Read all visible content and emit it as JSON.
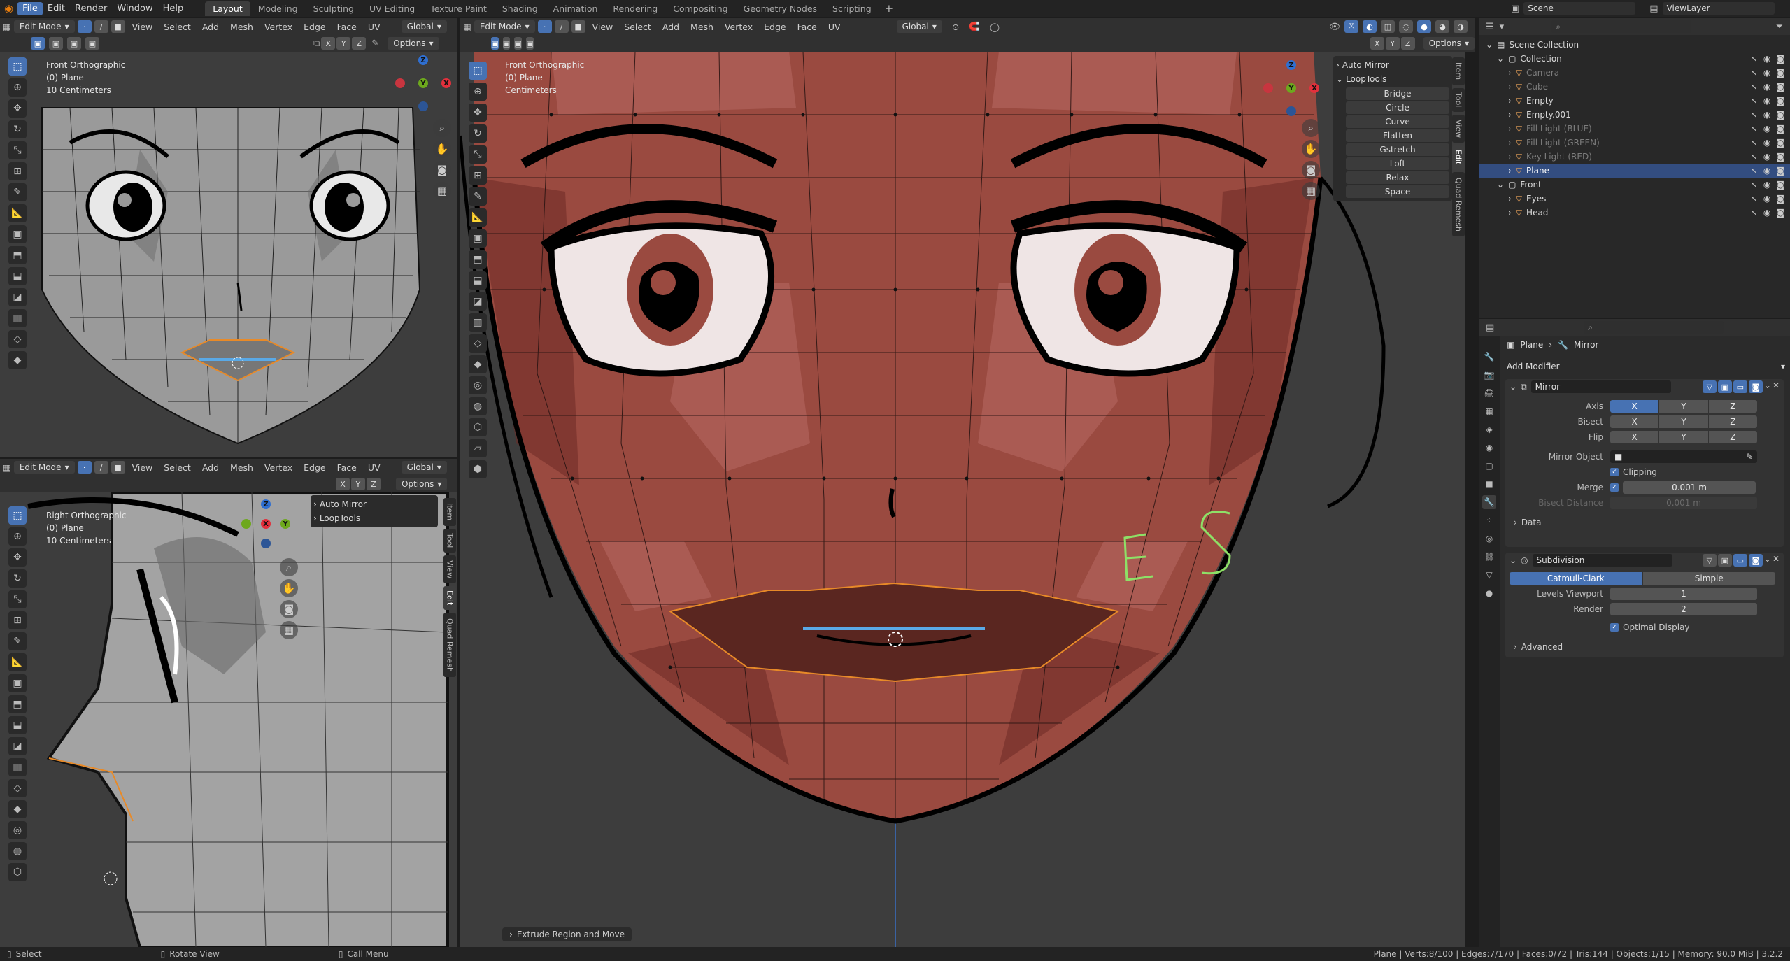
{
  "topbar": {
    "menus": [
      "File",
      "Edit",
      "Render",
      "Window",
      "Help"
    ],
    "workspaces": [
      "Layout",
      "Modeling",
      "Sculpting",
      "UV Editing",
      "Texture Paint",
      "Shading",
      "Animation",
      "Rendering",
      "Compositing",
      "Geometry Nodes",
      "Scripting"
    ],
    "active_workspace": "Layout",
    "scene": "Scene",
    "viewlayer": "ViewLayer"
  },
  "viewport_header": {
    "mode": "Edit Mode",
    "menus": [
      "View",
      "Select",
      "Add",
      "Mesh",
      "Vertex",
      "Edge",
      "Face",
      "UV"
    ],
    "orientation": "Global",
    "axes": [
      "X",
      "Y",
      "Z"
    ],
    "options": "Options"
  },
  "viewport_topleft": {
    "view_name": "Front Orthographic",
    "object": "(0) Plane",
    "scale": "10 Centimeters"
  },
  "viewport_bottomleft": {
    "view_name": "Right Orthographic",
    "object": "(0) Plane",
    "scale": "10 Centimeters"
  },
  "viewport_main": {
    "view_name": "Front Orthographic",
    "object": "(0) Plane",
    "scale": "Centimeters",
    "last_op": "Extrude Region and Move"
  },
  "npanel": {
    "auto_mirror": "Auto Mirror",
    "looptools": "LoopTools",
    "looptools_ops": [
      "Bridge",
      "Circle",
      "Curve",
      "Flatten",
      "Gstretch",
      "Loft",
      "Relax",
      "Space"
    ],
    "tabs": [
      "Item",
      "Tool",
      "View",
      "Edit",
      "Quad Remesh"
    ]
  },
  "gizmo": {
    "x": "X",
    "y": "Y",
    "z": "Z"
  },
  "drawing": {
    "signature": "E S"
  },
  "outliner": {
    "rows": [
      {
        "label": "Scene Collection",
        "indent": 0,
        "dim": false,
        "sel": false
      },
      {
        "label": "Collection",
        "indent": 1,
        "dim": false,
        "sel": false
      },
      {
        "label": "Camera",
        "indent": 2,
        "dim": true,
        "sel": false
      },
      {
        "label": "Cube",
        "indent": 2,
        "dim": true,
        "sel": false
      },
      {
        "label": "Empty",
        "indent": 2,
        "dim": false,
        "sel": false
      },
      {
        "label": "Empty.001",
        "indent": 2,
        "dim": false,
        "sel": false
      },
      {
        "label": "Fill Light (BLUE)",
        "indent": 2,
        "dim": true,
        "sel": false
      },
      {
        "label": "Fill Light (GREEN)",
        "indent": 2,
        "dim": true,
        "sel": false
      },
      {
        "label": "Key Light (RED)",
        "indent": 2,
        "dim": true,
        "sel": false
      },
      {
        "label": "Plane",
        "indent": 2,
        "dim": false,
        "sel": true
      },
      {
        "label": "Front",
        "indent": 1,
        "dim": false,
        "sel": false
      },
      {
        "label": "Eyes",
        "indent": 2,
        "dim": false,
        "sel": false
      },
      {
        "label": "Head",
        "indent": 2,
        "dim": false,
        "sel": false
      }
    ]
  },
  "properties": {
    "breadcrumb_object": "Plane",
    "breadcrumb_modifier": "Mirror",
    "add_modifier": "Add Modifier",
    "mirror": {
      "name": "Mirror",
      "axis_label": "Axis",
      "bisect_label": "Bisect",
      "flip_label": "Flip",
      "xyz": [
        "X",
        "Y",
        "Z"
      ],
      "mirror_object_label": "Mirror Object",
      "clipping_label": "Clipping",
      "merge_label": "Merge",
      "merge_value": "0.001 m",
      "bisect_distance_label": "Bisect Distance",
      "bisect_distance_value": "0.001 m",
      "data_label": "Data"
    },
    "subdivision": {
      "name": "Subdivision",
      "catmull": "Catmull-Clark",
      "simple": "Simple",
      "levels_label": "Levels Viewport",
      "levels_value": "1",
      "render_label": "Render",
      "render_value": "2",
      "optimal_label": "Optimal Display",
      "advanced_label": "Advanced"
    }
  },
  "statusbar": {
    "select": "Select",
    "rotate": "Rotate View",
    "menu": "Call Menu",
    "stats": "Plane | Verts:8/100 | Edges:7/170 | Faces:0/72 | Tris:144 | Objects:1/15 | Memory: 90.0 MiB | 3.2.2"
  },
  "colors": {
    "accent": "#4772b3",
    "skin": "#9a4a40",
    "gray_mesh": "#9a9a9a",
    "grid_bg": "#3d3d3d"
  }
}
